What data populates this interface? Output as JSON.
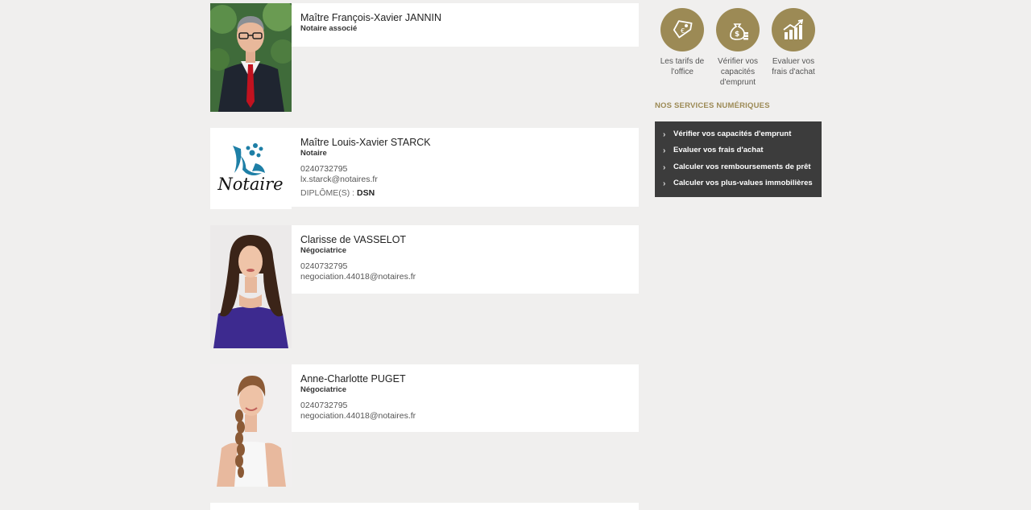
{
  "members": [
    {
      "name": "Maître François-Xavier JANNIN",
      "role": "Notaire associé"
    },
    {
      "name": "Maître Louis-Xavier STARCK",
      "role": "Notaire",
      "phone": "0240732795",
      "email": "lx.starck@notaires.fr",
      "diploma_label": "DIPLÔME(S) :",
      "diploma_value": "DSN",
      "logo_text": "Notaire"
    },
    {
      "name": "Clarisse de VASSELOT",
      "role": "Négociatrice",
      "phone": "0240732795",
      "email": "negociation.44018@notaires.fr"
    },
    {
      "name": "Anne-Charlotte PUGET",
      "role": "Négociatrice",
      "phone": "0240732795",
      "email": "negociation.44018@notaires.fr"
    }
  ],
  "tools": [
    {
      "label": "Les tarifs de l'office",
      "icon": "price-tag-icon"
    },
    {
      "label": "Vérifier vos capacités d'emprunt",
      "icon": "money-bag-icon"
    },
    {
      "label": "Evaluer vos frais d'achat",
      "icon": "growth-chart-icon"
    }
  ],
  "services": {
    "title": "NOS SERVICES NUMÉRIQUES",
    "items": [
      "Vérifier vos capacités d'emprunt",
      "Evaluer vos frais d'achat",
      "Calculer vos remboursements de prêt",
      "Calculer vos plus-values immobilières"
    ]
  },
  "colors": {
    "accent": "#9c8a55",
    "services_bg": "#3c3c3c",
    "page_bg": "#f0efee"
  }
}
